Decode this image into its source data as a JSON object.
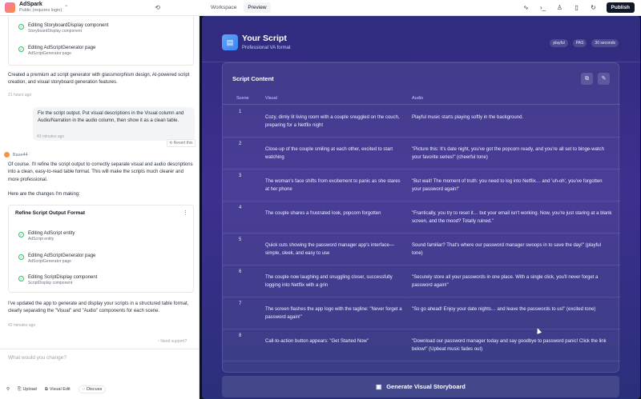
{
  "app": {
    "name": "AdSpark",
    "subtitle": "Public (requires login)"
  },
  "tabs": [
    {
      "label": "Workspace"
    },
    {
      "label": "Preview"
    }
  ],
  "publish_label": "Publish",
  "chat": {
    "card1": [
      {
        "title": "Editing StoryboardDisplay component",
        "sub": "StoryboardDisplay component"
      },
      {
        "title": "Editing AdScriptGenerator page",
        "sub": "AdScriptGenerator page"
      }
    ],
    "summary": "Created a premium ad script generator with glassmorphism design, AI-powered script creation, and visual storyboard generation features.",
    "summary_time": "21 hours ago",
    "user_message": "Fix the script output. Put visual descriptions in the Visual column and Audio/Narration in the audio column, then show it as a clean table.",
    "revert_label": "Revert this",
    "user_time": "43 minutes ago",
    "sender": "Base44",
    "reply1": "Of course. I'll refine the script output to correctly separate visual and audio descriptions into a clean, easy-to-read table format. This will make the scripts much clearer and more professional.",
    "reply2": "Here are the changes I'm making:",
    "refine_title": "Refine Script Output Format",
    "card2": [
      {
        "title": "Editing AdScript entity",
        "sub": "AdScript entity"
      },
      {
        "title": "Editing AdScriptGenerator page",
        "sub": "AdScriptGenerator page"
      },
      {
        "title": "Editing ScriptDisplay component",
        "sub": "ScriptDisplay component"
      }
    ],
    "reply3": "I've updated the app to generate and display your scripts in a structured table format, clearly separating the \"Visual\" and \"Audio\" components for each scene.",
    "reply_time": "42 minutes ago",
    "support": "Need support?",
    "prompt_placeholder": "What would you change?",
    "toolbar": {
      "upload": "Upload",
      "visual_edit": "Visual Edit",
      "discuss": "Discuss"
    }
  },
  "preview": {
    "title": "Your Script",
    "subtitle": "Professional VA format",
    "badges": [
      "playful",
      "PAS",
      "30 seconds"
    ],
    "content_heading": "Script Content",
    "columns": [
      "Scene",
      "Visual",
      "Audio"
    ],
    "rows": [
      {
        "scene": "1",
        "visual": "Cozy, dimly lit living room with a couple snuggled on the couch, preparing for a Netflix night",
        "audio": "Playful music starts playing softly in the background."
      },
      {
        "scene": "2",
        "visual": "Close-up of the couple smiling at each other, excited to start watching",
        "audio": "\"Picture this: It's date night, you've got the popcorn ready, and you're all set to binge-watch your favorite series!\" (cheerful tone)"
      },
      {
        "scene": "3",
        "visual": "The woman's face shifts from excitement to panic as she stares at her phone",
        "audio": "\"But wait! The moment of truth: you need to log into Netflix… and 'uh-oh', you've forgotten your password again!\""
      },
      {
        "scene": "4",
        "visual": "The couple shares a frustrated look, popcorn forgotten",
        "audio": "\"Frantically, you try to reset it… but your email isn't working. Now, you're just staring at a blank screen, and the mood? Totally ruined.\""
      },
      {
        "scene": "5",
        "visual": "Quick cuts showing the password manager app's interface—simple, sleek, and easy to use",
        "audio": "Sound familiar? That's where our password manager swoops in to save the day!\" (playful tone)"
      },
      {
        "scene": "6",
        "visual": "The couple now laughing and snuggling closer, successfully logging into Netflix with a grin",
        "audio": "\"Securely store all your passwords in one place. With a single click, you'll never forget a password again!\""
      },
      {
        "scene": "7",
        "visual": "The screen flashes the app logo with the tagline: \"Never forget a password again!\"",
        "audio": "\"So go ahead! Enjoy your date nights… and leave the passwords to us!\" (excited tone)"
      },
      {
        "scene": "8",
        "visual": "Call-to-action button appears: \"Get Started Now\"",
        "audio": "\"Download our password manager today and say goodbye to password panic! Click the link below!\" (Upbeat music fades out)"
      }
    ],
    "generate_label": "Generate Visual Storyboard"
  },
  "colors": {
    "accent": "#3b82f6",
    "panel": "#302c7e",
    "success": "#22c55e"
  }
}
